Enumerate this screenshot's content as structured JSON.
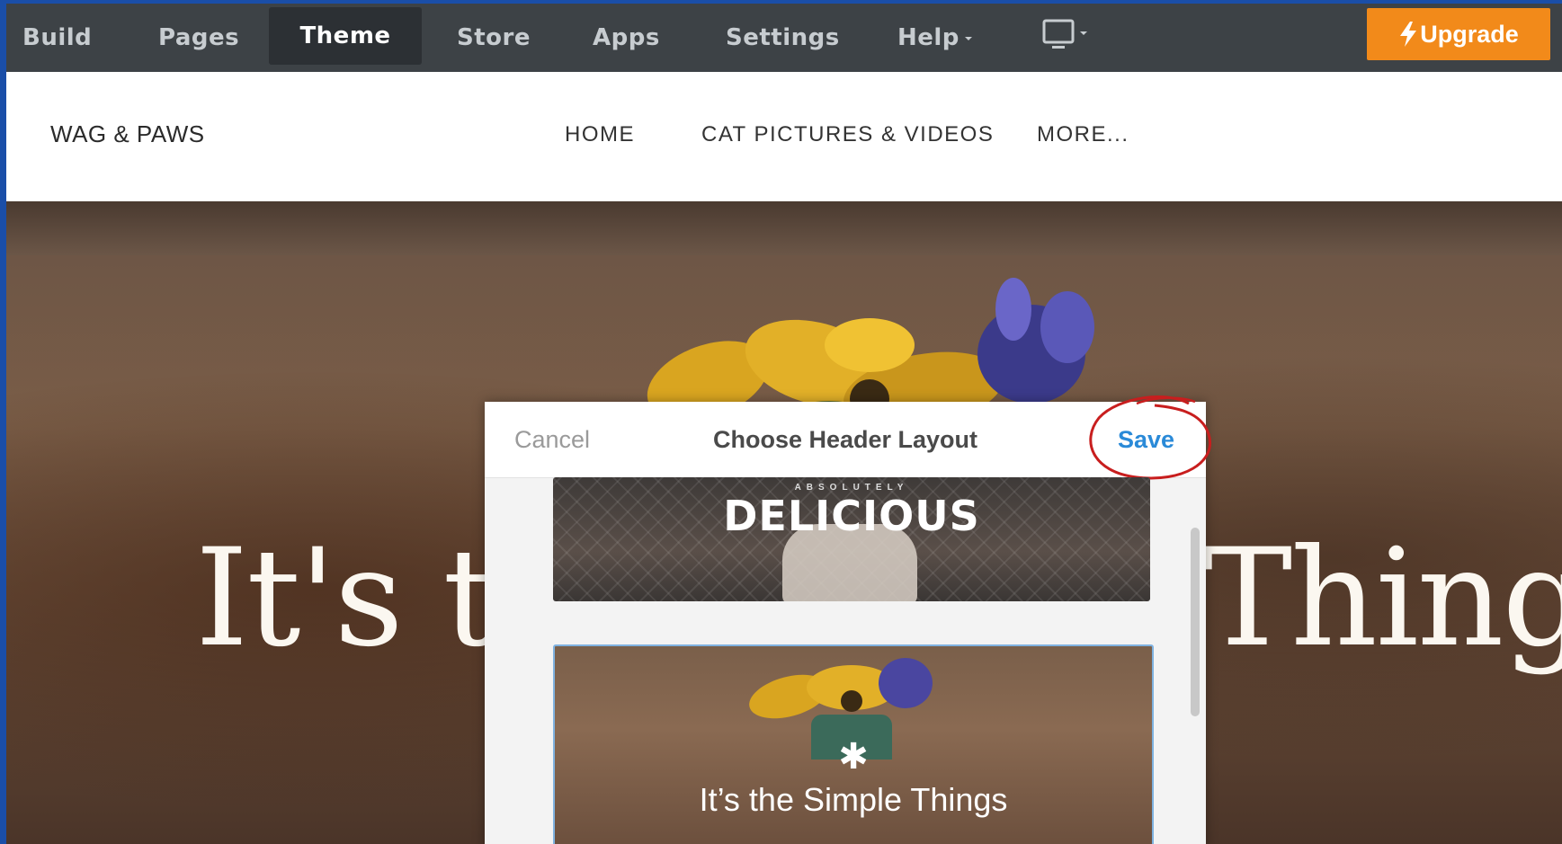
{
  "topbar": {
    "items": [
      {
        "label": "Build"
      },
      {
        "label": "Pages"
      },
      {
        "label": "Theme"
      },
      {
        "label": "Store"
      },
      {
        "label": "Apps"
      },
      {
        "label": "Settings"
      },
      {
        "label": "Help"
      }
    ],
    "upgrade_label": "Upgrade"
  },
  "site": {
    "logo": "WAG & PAWS",
    "nav": [
      "HOME",
      "CAT PICTURES & VIDEOS",
      "MORE..."
    ]
  },
  "hero": {
    "headline": "It's the Simple Things"
  },
  "modal": {
    "cancel_label": "Cancel",
    "title": "Choose Header Layout",
    "save_label": "Save",
    "layouts": [
      {
        "kicker": "ABSOLUTELY",
        "title": "DELICIOUS"
      },
      {
        "title": "It’s the Simple Things"
      }
    ]
  },
  "colors": {
    "topbar_bg": "#3d4246",
    "upgrade_bg": "#f28a1a",
    "save_blue": "#2a8ad8",
    "annotation_red": "#c81e1e",
    "frame_blue": "#1a4ea8"
  },
  "icons": {
    "device": "desktop-monitor-icon",
    "upgrade": "lightning-bolt-icon"
  }
}
